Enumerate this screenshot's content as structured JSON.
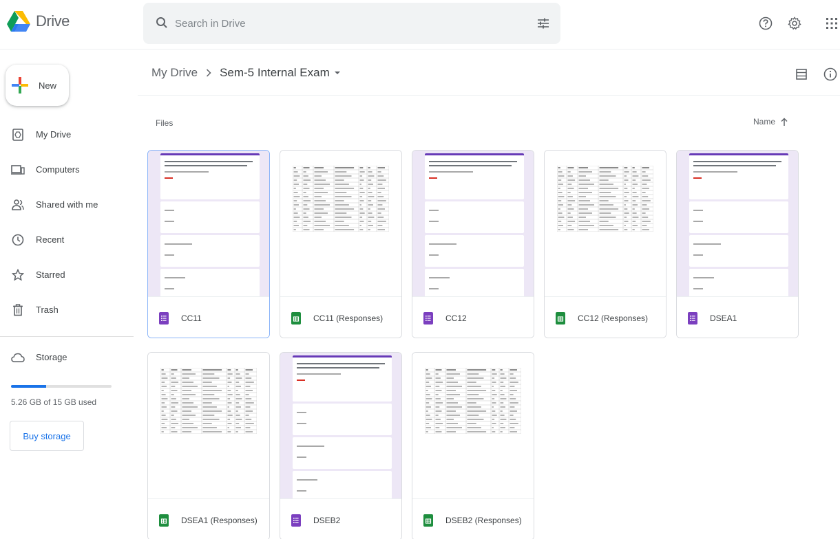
{
  "app": {
    "logo_text": "Drive"
  },
  "search": {
    "placeholder": "Search in Drive",
    "value": ""
  },
  "sidebar": {
    "new_label": "New",
    "items": [
      {
        "label": "My Drive",
        "icon": "my-drive-icon"
      },
      {
        "label": "Computers",
        "icon": "computer-icon"
      },
      {
        "label": "Shared with me",
        "icon": "people-icon"
      },
      {
        "label": "Recent",
        "icon": "clock-icon"
      },
      {
        "label": "Starred",
        "icon": "star-icon"
      },
      {
        "label": "Trash",
        "icon": "trash-icon"
      }
    ],
    "storage_label": "Storage",
    "storage_used_text": "5.26 GB of 15 GB used",
    "storage_fraction": 0.35,
    "buy_storage_label": "Buy storage"
  },
  "breadcrumb": {
    "root": "My Drive",
    "current": "Sem-5 Internal Exam"
  },
  "main": {
    "section_label": "Files",
    "sort_label": "Name"
  },
  "files": [
    {
      "name": "CC11",
      "type": "form",
      "selected": true
    },
    {
      "name": "CC11 (Responses)",
      "type": "sheet"
    },
    {
      "name": "CC12",
      "type": "form"
    },
    {
      "name": "CC12 (Responses)",
      "type": "sheet"
    },
    {
      "name": "DSEA1",
      "type": "form"
    },
    {
      "name": "DSEA1 (Responses)",
      "type": "sheet"
    },
    {
      "name": "DSEB2",
      "type": "form"
    },
    {
      "name": "DSEB2 (Responses)",
      "type": "sheet"
    }
  ],
  "colors": {
    "form": "#7b3fbf",
    "sheet": "#1e8e3e",
    "accent": "#1a73e8"
  }
}
